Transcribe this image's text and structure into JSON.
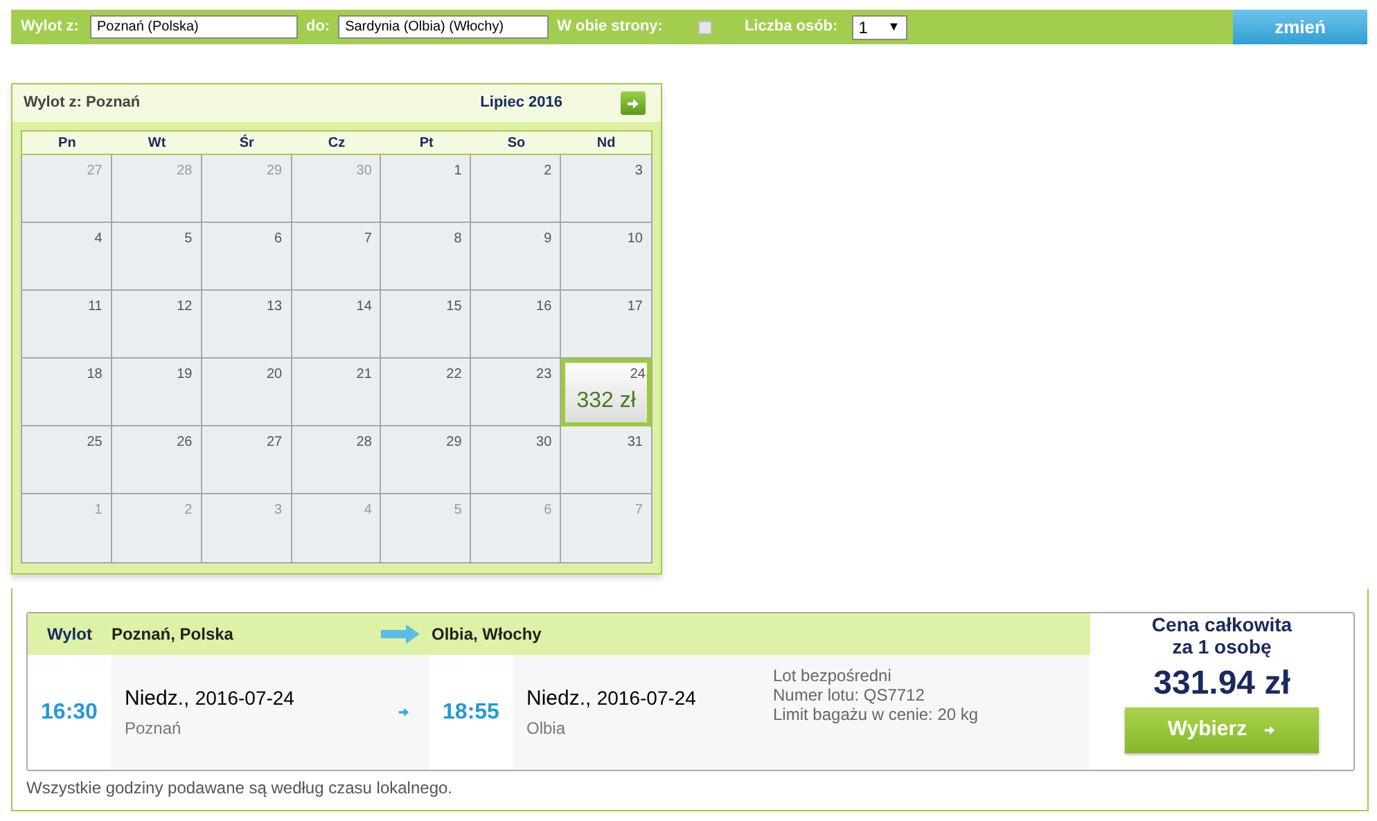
{
  "search_bar": {
    "from_label": "Wylot z:",
    "from_value": "Poznań (Polska)",
    "to_label": "do:",
    "to_value": "Sardynia (Olbia) (Włochy)",
    "round_trip_label": "W obie strony:",
    "round_trip": false,
    "persons_label": "Liczba osób:",
    "persons_value": "1",
    "persons_caret": "▼",
    "submit": "zmień"
  },
  "calendar": {
    "title": "Wylot z: Poznań",
    "month": "Lipiec 2016",
    "weekdays": [
      "Pn",
      "Wt",
      "Śr",
      "Cz",
      "Pt",
      "So",
      "Nd"
    ],
    "days": [
      {
        "day": "27",
        "muted": true,
        "selected": false
      },
      {
        "day": "28",
        "muted": true,
        "selected": false
      },
      {
        "day": "29",
        "muted": true,
        "selected": false
      },
      {
        "day": "30",
        "muted": true,
        "selected": false
      },
      {
        "day": "1",
        "muted": false,
        "selected": false
      },
      {
        "day": "2",
        "muted": false,
        "selected": false
      },
      {
        "day": "3",
        "muted": false,
        "selected": false
      },
      {
        "day": "4",
        "muted": false,
        "selected": false
      },
      {
        "day": "5",
        "muted": false,
        "selected": false
      },
      {
        "day": "6",
        "muted": false,
        "selected": false
      },
      {
        "day": "7",
        "muted": false,
        "selected": false
      },
      {
        "day": "8",
        "muted": false,
        "selected": false
      },
      {
        "day": "9",
        "muted": false,
        "selected": false
      },
      {
        "day": "10",
        "muted": false,
        "selected": false
      },
      {
        "day": "11",
        "muted": false,
        "selected": false
      },
      {
        "day": "12",
        "muted": false,
        "selected": false
      },
      {
        "day": "13",
        "muted": false,
        "selected": false
      },
      {
        "day": "14",
        "muted": false,
        "selected": false
      },
      {
        "day": "15",
        "muted": false,
        "selected": false
      },
      {
        "day": "16",
        "muted": false,
        "selected": false
      },
      {
        "day": "17",
        "muted": false,
        "selected": false
      },
      {
        "day": "18",
        "muted": false,
        "selected": false
      },
      {
        "day": "19",
        "muted": false,
        "selected": false
      },
      {
        "day": "20",
        "muted": false,
        "selected": false
      },
      {
        "day": "21",
        "muted": false,
        "selected": false
      },
      {
        "day": "22",
        "muted": false,
        "selected": false
      },
      {
        "day": "23",
        "muted": false,
        "selected": false
      },
      {
        "day": "24",
        "muted": false,
        "selected": true,
        "price": "332 zł"
      },
      {
        "day": "25",
        "muted": false,
        "selected": false
      },
      {
        "day": "26",
        "muted": false,
        "selected": false
      },
      {
        "day": "27",
        "muted": false,
        "selected": false
      },
      {
        "day": "28",
        "muted": false,
        "selected": false
      },
      {
        "day": "29",
        "muted": false,
        "selected": false
      },
      {
        "day": "30",
        "muted": false,
        "selected": false
      },
      {
        "day": "31",
        "muted": false,
        "selected": false
      },
      {
        "day": "1",
        "muted": true,
        "selected": false
      },
      {
        "day": "2",
        "muted": true,
        "selected": false
      },
      {
        "day": "3",
        "muted": true,
        "selected": false
      },
      {
        "day": "4",
        "muted": true,
        "selected": false
      },
      {
        "day": "5",
        "muted": true,
        "selected": false
      },
      {
        "day": "6",
        "muted": true,
        "selected": false
      },
      {
        "day": "7",
        "muted": true,
        "selected": false
      }
    ]
  },
  "flight": {
    "header_label": "Wylot",
    "origin": "Poznań, Polska",
    "destination": "Olbia, Włochy",
    "departure_time": "16:30",
    "departure_date_day": "Niedz.,",
    "departure_date": "2016-07-24",
    "departure_city": "Poznań",
    "arrival_time": "18:55",
    "arrival_date_day": "Niedz.,",
    "arrival_date": "2016-07-24",
    "arrival_city": "Olbia",
    "details": [
      "Lot bezpośredni",
      "Numer lotu: QS7712",
      "Limit bagażu w cenie: 20 kg"
    ],
    "price_label_1": "Cena całkowita",
    "price_label_2": "za 1 osobę",
    "price": "331.94 zł",
    "select_button": "Wybierz"
  },
  "footnote": "Wszystkie godziny podawane są według czasu lokalnego."
}
